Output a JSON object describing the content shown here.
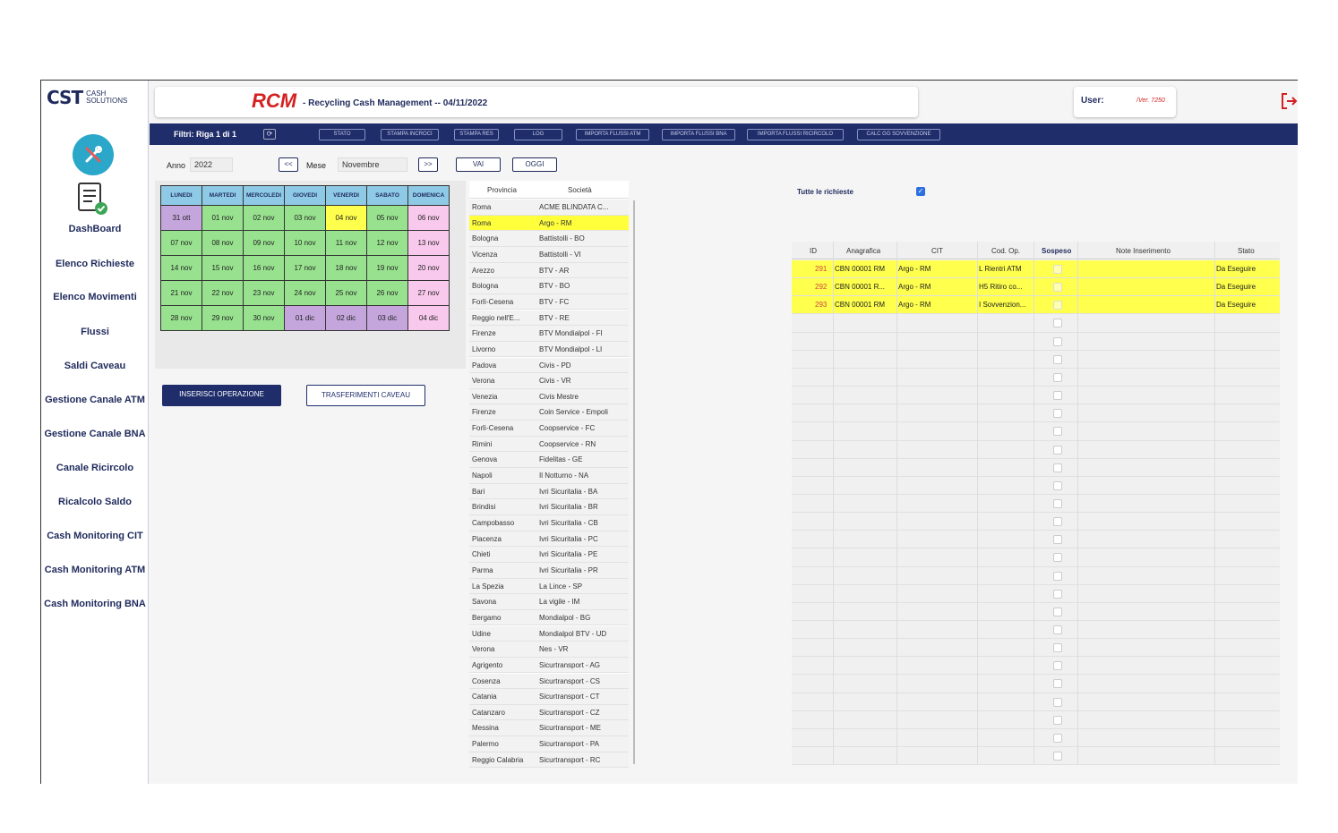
{
  "logo": {
    "mark": "CST",
    "sub1": "CASH",
    "sub2": "SOLUTIONS"
  },
  "header": {
    "rcm": "RCM",
    "title": "- Recycling Cash Management -- 04/11/2022",
    "user_label": "User:",
    "version": "/Ver. 7250"
  },
  "sidebar": {
    "items": [
      "DashBoard",
      "Elenco Richieste",
      "Elenco Movimenti",
      "Flussi",
      "Saldi Caveau",
      "Gestione Canale ATM",
      "Gestione Canale BNA",
      "Canale Ricircolo",
      "Ricalcolo Saldo",
      "Cash Monitoring CIT",
      "Cash Monitoring ATM",
      "Cash Monitoring BNA"
    ]
  },
  "filterbar": {
    "label": "Filtri: Riga 1 di 1",
    "buttons": [
      "STATO",
      "STAMPA INCROCI",
      "STAMPA RES",
      "LOG",
      "IMPORTA FLUSSI ATM",
      "IMPORTA FLUSSI BNA",
      "IMPORTA FLUSSI RICIRCOLO",
      "CALC GG SOVVENZIONE"
    ]
  },
  "nav": {
    "anno_label": "Anno",
    "anno": "2022",
    "prev": "<<",
    "mese_label": "Mese",
    "mese": "Novembre",
    "next": ">>",
    "vai": "VAI",
    "oggi": "OGGI"
  },
  "calendar": {
    "days": [
      "LUNEDI",
      "MARTEDI",
      "MERCOLEDI",
      "GIOVEDI",
      "VENERDI",
      "SABATO",
      "DOMENICA"
    ],
    "weeks": [
      [
        "31 ott",
        "01 nov",
        "02 nov",
        "03 nov",
        "04 nov",
        "05 nov",
        "06 nov"
      ],
      [
        "07 nov",
        "08 nov",
        "09 nov",
        "10 nov",
        "11 nov",
        "12 nov",
        "13 nov"
      ],
      [
        "14 nov",
        "15 nov",
        "16 nov",
        "17 nov",
        "18 nov",
        "19 nov",
        "20 nov"
      ],
      [
        "21 nov",
        "22 nov",
        "23 nov",
        "24 nov",
        "25 nov",
        "26 nov",
        "27 nov"
      ],
      [
        "28 nov",
        "29 nov",
        "30 nov",
        "01 dic",
        "02 dic",
        "03 dic",
        "04 dic"
      ]
    ],
    "colors": [
      [
        "v",
        "g",
        "g",
        "g",
        "y",
        "g",
        "p"
      ],
      [
        "g",
        "g",
        "g",
        "g",
        "g",
        "g",
        "p"
      ],
      [
        "g",
        "g",
        "g",
        "g",
        "g",
        "g",
        "p"
      ],
      [
        "g",
        "g",
        "g",
        "g",
        "g",
        "g",
        "p"
      ],
      [
        "g",
        "g",
        "g",
        "v",
        "v",
        "v",
        "p"
      ]
    ]
  },
  "actions": {
    "inserisci": "INSERISCI OPERAZIONE",
    "trasferimenti": "TRASFERIMENTI CAVEAU"
  },
  "provincia_list": {
    "headers": [
      "Provincia",
      "Società"
    ],
    "selected_index": 1,
    "rows": [
      [
        "Roma",
        "ACME BLINDATA C..."
      ],
      [
        "Roma",
        "Argo - RM"
      ],
      [
        "Bologna",
        "Battistolli - BO"
      ],
      [
        "Vicenza",
        "Battistolli - VI"
      ],
      [
        "Arezzo",
        "BTV - AR"
      ],
      [
        "Bologna",
        "BTV - BO"
      ],
      [
        "Forlì-Cesena",
        "BTV - FC"
      ],
      [
        "Reggio nell'E...",
        "BTV - RE"
      ],
      [
        "Firenze",
        "BTV Mondialpol - FI"
      ],
      [
        "Livorno",
        "BTV Mondialpol - LI"
      ],
      [
        "Padova",
        "Civis - PD"
      ],
      [
        "Verona",
        "Civis - VR"
      ],
      [
        "Venezia",
        "Civis Mestre"
      ],
      [
        "Firenze",
        "Coin Service - Empoli"
      ],
      [
        "Forlì-Cesena",
        "Coopservice - FC"
      ],
      [
        "Rimini",
        "Coopservice - RN"
      ],
      [
        "Genova",
        "Fidelitas - GE"
      ],
      [
        "Napoli",
        "Il Notturno - NA"
      ],
      [
        "Bari",
        "Ivri Sicuritalia - BA"
      ],
      [
        "Brindisi",
        "Ivri Sicuritalia - BR"
      ],
      [
        "Campobasso",
        "Ivri Sicuritalia - CB"
      ],
      [
        "Piacenza",
        "Ivri Sicuritalia - PC"
      ],
      [
        "Chieti",
        "Ivri Sicuritalia - PE"
      ],
      [
        "Parma",
        "Ivri Sicuritalia - PR"
      ],
      [
        "La Spezia",
        "La Lince - SP"
      ],
      [
        "Savona",
        "La vigile - IM"
      ],
      [
        "Bergamo",
        "Mondialpol - BG"
      ],
      [
        "Udine",
        "Mondialpol BTV - UD"
      ],
      [
        "Verona",
        "Nes - VR"
      ],
      [
        "Agrigento",
        "Sicurtransport - AG"
      ],
      [
        "Cosenza",
        "Sicurtransport - CS"
      ],
      [
        "Catania",
        "Sicurtransport - CT"
      ],
      [
        "Catanzaro",
        "Sicurtransport - CZ"
      ],
      [
        "Messina",
        "Sicurtransport - ME"
      ],
      [
        "Palermo",
        "Sicurtransport - PA"
      ],
      [
        "Reggio Calabria",
        "Sicurtransport - RC"
      ]
    ]
  },
  "requests": {
    "tutte_label": "Tutte le richieste",
    "headers": [
      "ID",
      "Anagrafica",
      "CIT",
      "Cod. Op.",
      "Sospeso",
      "Note Inserimento",
      "Stato"
    ],
    "rows": [
      [
        "291",
        "CBN 00001 RM",
        "Argo - RM",
        "L Rientri ATM",
        "",
        "",
        "Da Eseguire"
      ],
      [
        "292",
        "CBN 00001 R...",
        "Argo - RM",
        "H5 Ritiro co...",
        "",
        "",
        "Da Eseguire"
      ],
      [
        "293",
        "CBN 00001 RM",
        "Argo - RM",
        "I Sovvenzion...",
        "",
        "",
        "Da Eseguire"
      ]
    ],
    "empty_rows": 25
  }
}
